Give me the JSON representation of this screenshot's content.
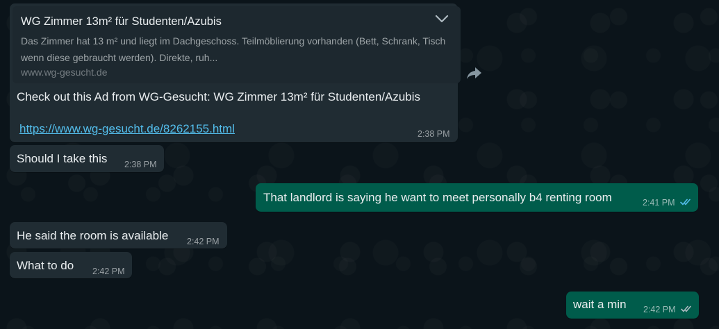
{
  "chat": {
    "preview": {
      "title": "WG Zimmer 13m² für Studenten/Azubis",
      "description": "Das Zimmer hat 13 m² und liegt im Dachgeschoss. Teilmöblierung vorhanden (Bett, Schrank, Tisch wenn diese gebraucht werden). Direkte, ruh...",
      "domain": "www.wg-gesucht.de"
    },
    "messages": [
      {
        "body": "Check out this Ad from WG-Gesucht: WG Zimmer 13m² für Studenten/Azubis",
        "link": "https://www.wg-gesucht.de/8262155.html",
        "time": "2:38 PM",
        "direction": "incoming"
      },
      {
        "body": "Should I take this",
        "time": "2:38 PM",
        "direction": "incoming"
      },
      {
        "body": "That landlord is saying he want to meet personally b4 renting room",
        "time": "2:41 PM",
        "direction": "outgoing",
        "status": "read"
      },
      {
        "body": "He said the room is available",
        "time": "2:42 PM",
        "direction": "incoming"
      },
      {
        "body": "What to do",
        "time": "2:42 PM",
        "direction": "incoming"
      },
      {
        "body": "wait a min",
        "time": "2:42 PM",
        "direction": "outgoing",
        "status": "delivered"
      }
    ]
  },
  "icons": {
    "preview_menu": "chevron-down-icon",
    "forward": "forward-icon",
    "read_receipt": "double-check-icon"
  },
  "colors": {
    "background": "#0b141a",
    "incoming_bubble": "#202c33",
    "outgoing_bubble": "#005c4b",
    "link": "#53bdeb",
    "read_ticks": "#53bdeb",
    "delivered_ticks": "#aebac1"
  }
}
